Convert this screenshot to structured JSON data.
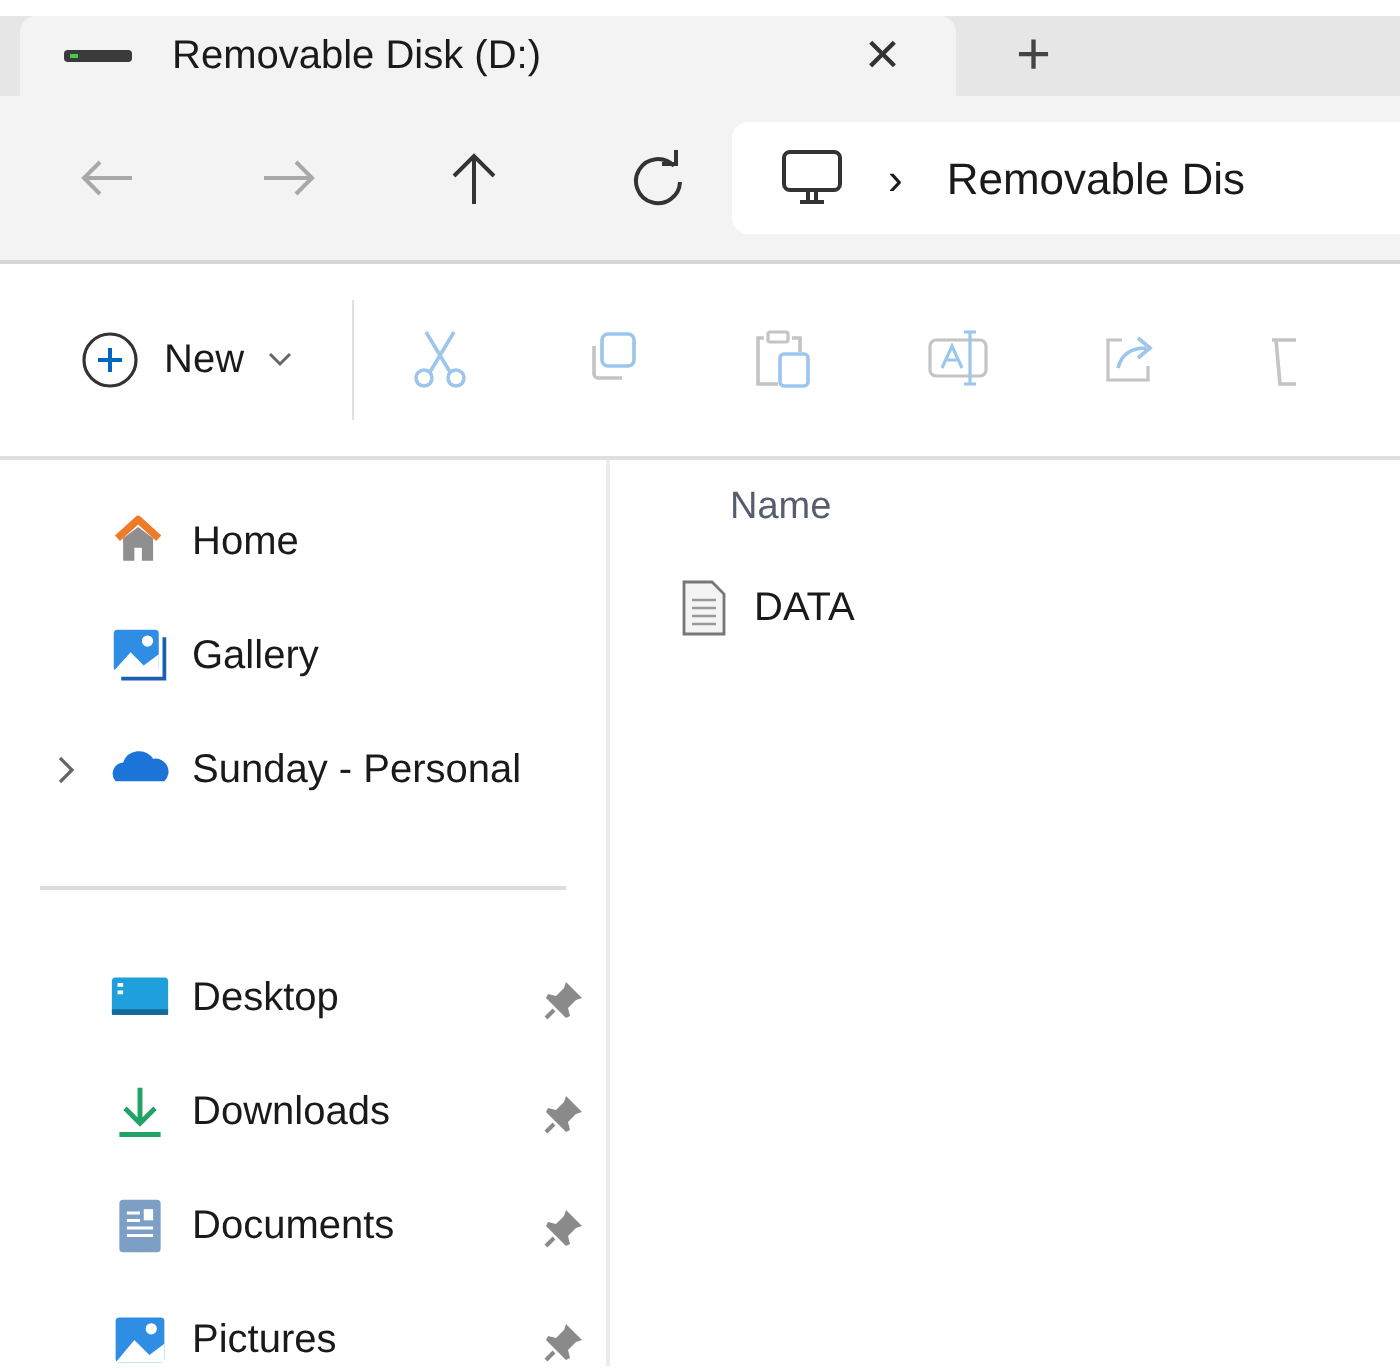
{
  "tabs": [
    {
      "title": "Removable Disk (D:)",
      "selected": true,
      "close": "×"
    }
  ],
  "new_tab": "+",
  "nav": [
    {
      "disabled": true
    },
    {
      "disabled": true
    },
    {
      "disabled": false
    },
    {
      "disabled": false
    }
  ],
  "address": {
    "separator": "›",
    "crumb": "Removable Dis"
  },
  "toolbar": {
    "new": {
      "label": "New",
      "disabled": false
    },
    "actions": [
      {
        "disabled": true
      },
      {
        "disabled": true
      },
      {
        "disabled": true
      },
      {
        "disabled": true
      },
      {
        "disabled": true
      },
      {
        "disabled": true
      }
    ]
  },
  "sidebar": {
    "groups": [
      [
        {
          "label": "Home",
          "expandable": false,
          "pinned": false
        },
        {
          "label": "Gallery",
          "expandable": false,
          "pinned": false
        },
        {
          "label": "Sunday - Personal",
          "expandable": true,
          "pinned": false
        }
      ],
      [
        {
          "label": "Desktop",
          "expandable": false,
          "pinned": true
        },
        {
          "label": "Downloads",
          "expandable": false,
          "pinned": true
        },
        {
          "label": "Documents",
          "expandable": false,
          "pinned": true
        },
        {
          "label": "Pictures",
          "expandable": false,
          "pinned": true
        }
      ]
    ]
  },
  "files": {
    "columns": [
      "Name"
    ],
    "rows": [
      {
        "name": "DATA"
      }
    ]
  }
}
